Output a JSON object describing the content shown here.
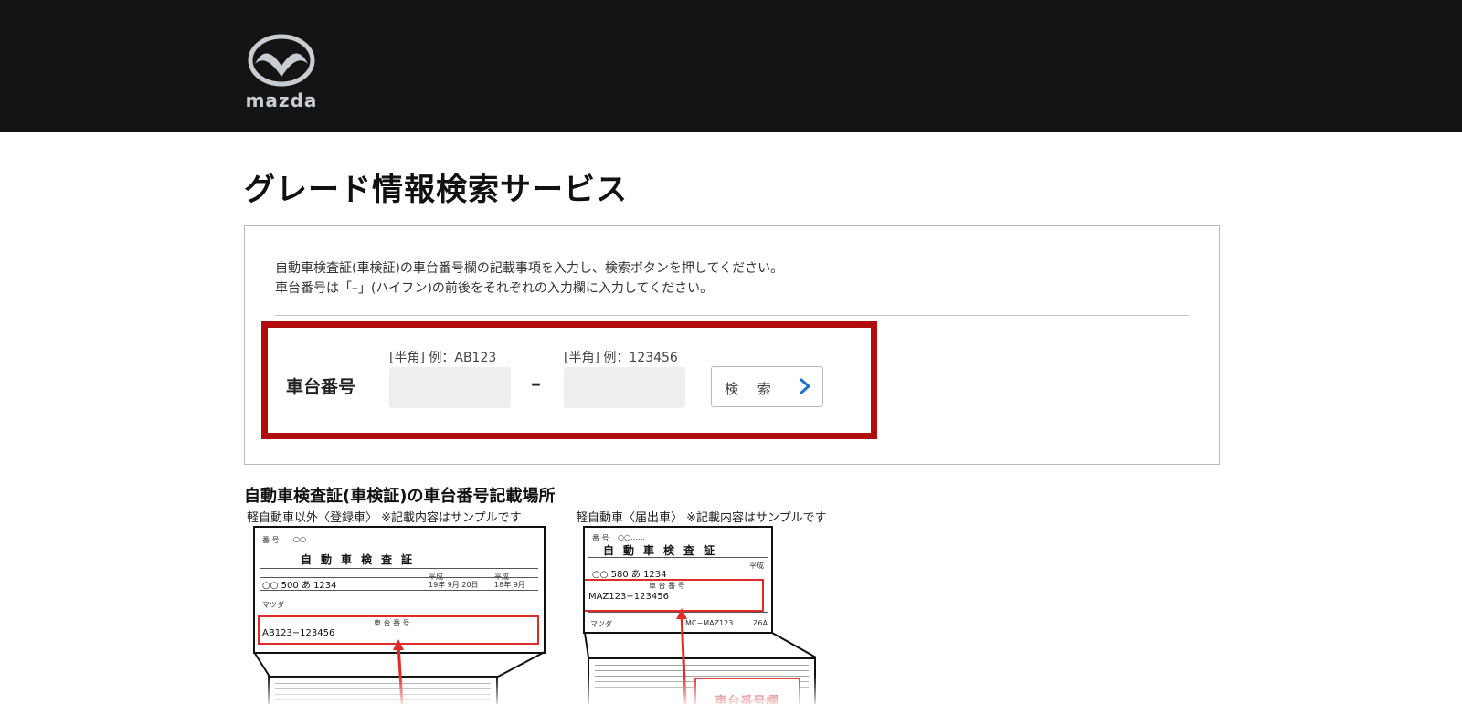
{
  "header": {
    "logo_text": "mazda"
  },
  "page": {
    "title": "グレード情報検索サービス"
  },
  "panel": {
    "instruction_1": "自動車検査証(車検証)の車台番号欄の記載事項を入力し、検索ボタンを押してください。",
    "instruction_2": "車台番号は「–」(ハイフン)の前後をそれぞれの入力欄に入力してください。",
    "field_label": "車台番号",
    "hint_1": "[半角] 例：AB123",
    "hint_2": "[半角] 例：123456",
    "input_1_value": "",
    "input_2_value": "",
    "hyphen": "–",
    "search_label": "検 索"
  },
  "section": {
    "title": "自動車検査証(車検証)の車台番号記載場所",
    "caption_1": "軽自動車以外〈登録車〉 ※記載内容はサンプルです",
    "caption_2": "軽自動車〈届出車〉 ※記載内容はサンプルです"
  },
  "doc1": {
    "number_label": "番 号",
    "number_value": "○○……",
    "title": "自動車検査証",
    "reg": "○○ 500 あ 1234",
    "heisei_1": "平成",
    "date_1": "19年 9月 20日",
    "heisei_2": "平成",
    "date_2": "18年 9月",
    "maker": "マツダ",
    "frame_label": "車 台 番 号",
    "frame_value": "AB123−123456"
  },
  "doc2": {
    "number_label": "番 号",
    "number_value": "○○……",
    "title": "自動車検査証",
    "heisei": "平成",
    "reg": "○○ 580 あ 1234",
    "frame_label": "車 台 番 号",
    "frame_value": "MAZ123−123456",
    "maker": "マツダ",
    "model": "MC−MAZ123",
    "engine": "Z6A"
  },
  "callout": {
    "label": "車台番号欄"
  },
  "colors": {
    "header_bg": "#141414",
    "highlight_red": "#b00d0d",
    "doc_red": "#e02b2b",
    "arrow_blue": "#1a73c8"
  }
}
